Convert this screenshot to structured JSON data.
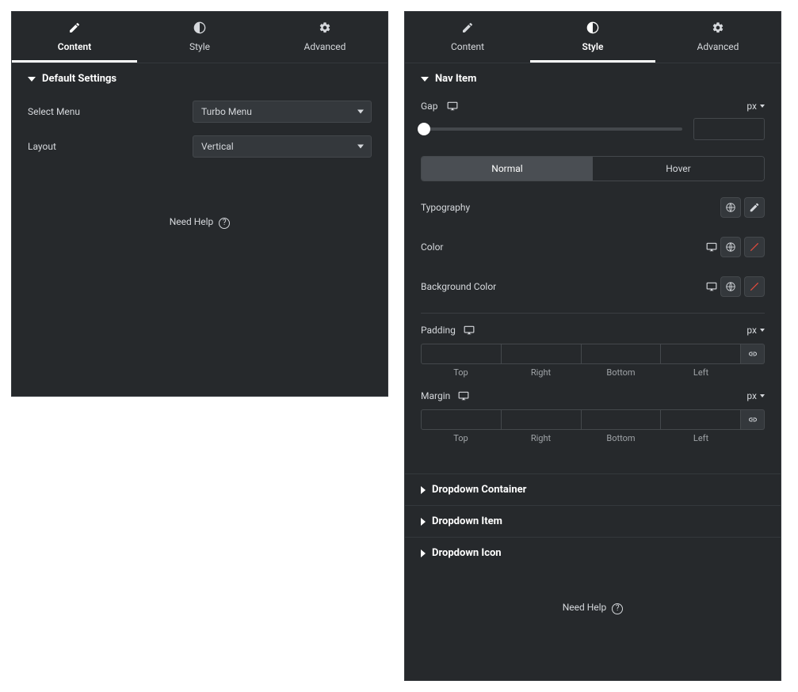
{
  "tabs": {
    "content": "Content",
    "style": "Style",
    "advanced": "Advanced"
  },
  "left": {
    "section_title": "Default Settings",
    "select_menu_label": "Select Menu",
    "select_menu_value": "Turbo Menu",
    "layout_label": "Layout",
    "layout_value": "Vertical",
    "help": "Need Help"
  },
  "right": {
    "nav_item": {
      "title": "Nav Item",
      "gap_label": "Gap",
      "unit": "px",
      "state_normal": "Normal",
      "state_hover": "Hover",
      "typography_label": "Typography",
      "color_label": "Color",
      "bg_color_label": "Background Color",
      "padding_label": "Padding",
      "margin_label": "Margin",
      "sides": {
        "top": "Top",
        "right": "Right",
        "bottom": "Bottom",
        "left": "Left"
      }
    },
    "sections": {
      "dropdown_container": "Dropdown Container",
      "dropdown_item": "Dropdown Item",
      "dropdown_icon": "Dropdown Icon"
    },
    "help": "Need Help"
  }
}
